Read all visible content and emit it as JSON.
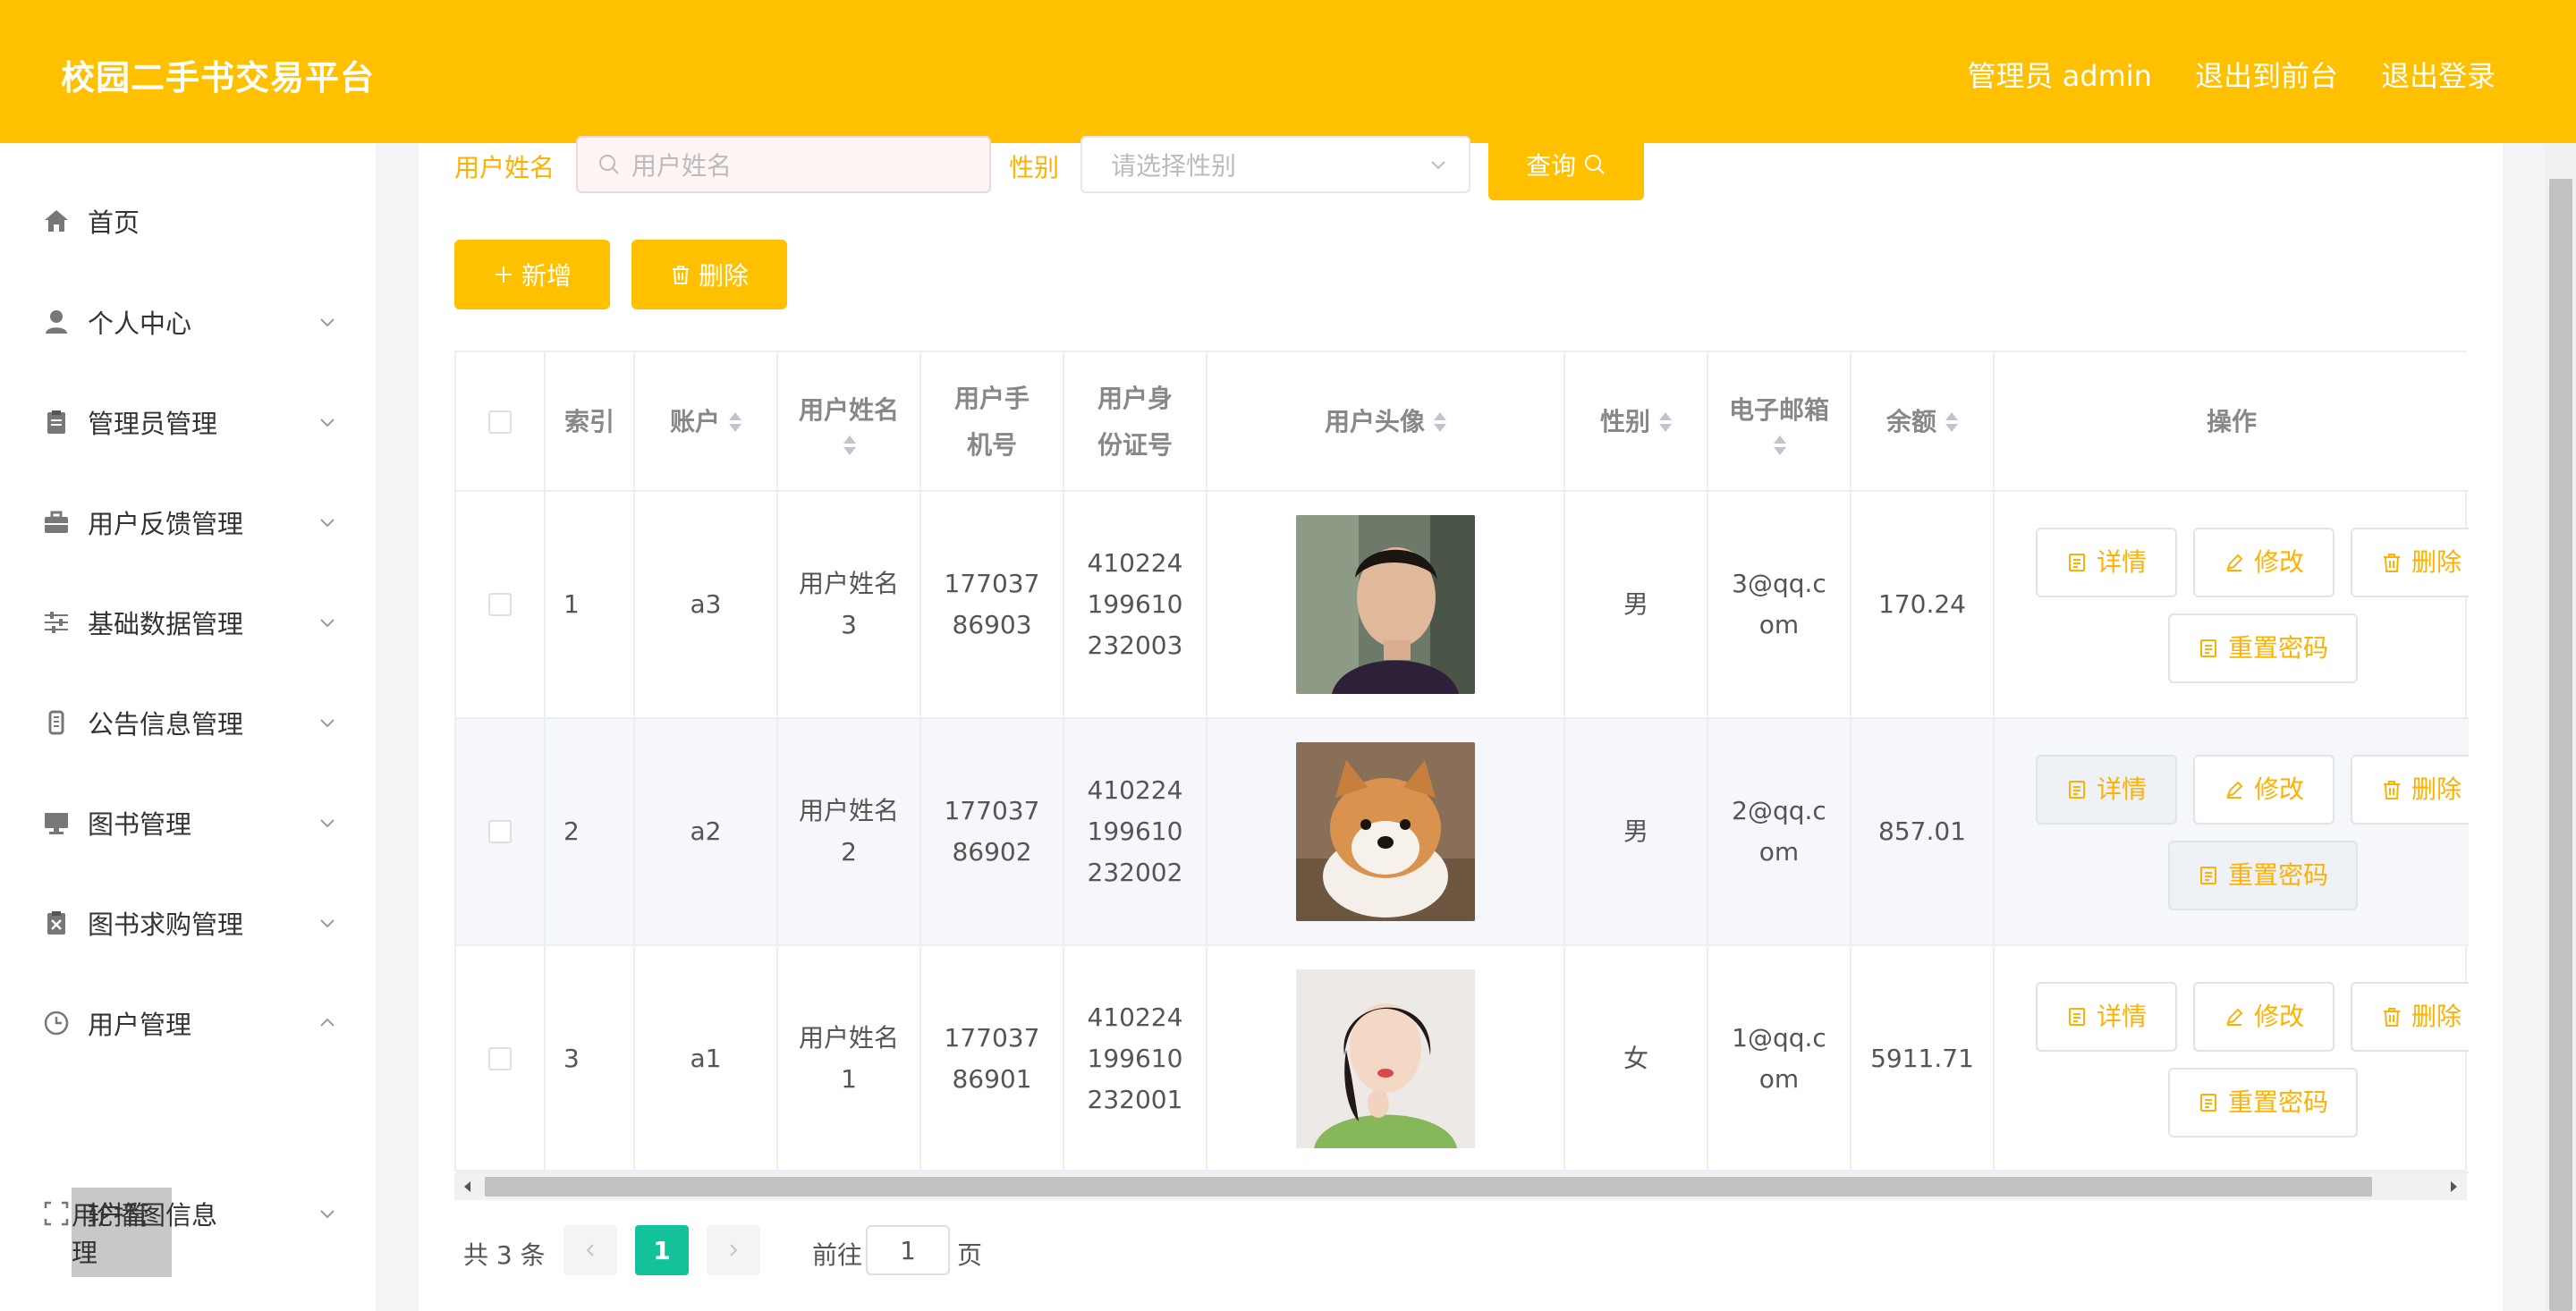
{
  "header": {
    "title": "校园二手书交易平台",
    "admin_label": "管理员 admin",
    "back_to_front": "退出到前台",
    "logout": "退出登录"
  },
  "sidebar": {
    "items": [
      {
        "label": "首页",
        "icon": "home-icon"
      },
      {
        "label": "个人中心",
        "icon": "user-icon"
      },
      {
        "label": "管理员管理",
        "icon": "clipboard-icon"
      },
      {
        "label": "用户反馈管理",
        "icon": "briefcase-icon"
      },
      {
        "label": "基础数据管理",
        "icon": "sliders-icon"
      },
      {
        "label": "公告信息管理",
        "icon": "notice-icon"
      },
      {
        "label": "图书管理",
        "icon": "monitor-icon"
      },
      {
        "label": "图书求购管理",
        "icon": "clipboard-x-icon"
      },
      {
        "label": "用户管理",
        "icon": "clock-icon"
      },
      {
        "label": "轮播图信息",
        "icon": "frame-icon"
      }
    ],
    "submenu_active": "用户管理"
  },
  "search": {
    "name_label": "用户姓名",
    "name_placeholder": "用户姓名",
    "gender_label": "性别",
    "gender_placeholder": "请选择性别",
    "query_button": "查询"
  },
  "toolbar": {
    "add_button": "新增",
    "delete_button": "删除"
  },
  "table": {
    "headers": {
      "index": "索引",
      "account": "账户",
      "name": "用户姓名",
      "phone": "用户手机号",
      "idcard": "用户身份证号",
      "avatar": "用户头像",
      "gender": "性别",
      "email": "电子邮箱",
      "balance": "余额",
      "ops": "操作"
    },
    "rows": [
      {
        "index": "1",
        "account": "a3",
        "name": "用户姓名3",
        "phone": "17703786903",
        "idcard": "410224199610232003",
        "gender": "男",
        "email": "3@qq.com",
        "balance": "170.24"
      },
      {
        "index": "2",
        "account": "a2",
        "name": "用户姓名2",
        "phone": "17703786902",
        "idcard": "410224199610232002",
        "gender": "男",
        "email": "2@qq.com",
        "balance": "857.01"
      },
      {
        "index": "3",
        "account": "a1",
        "name": "用户姓名1",
        "phone": "17703786901",
        "idcard": "410224199610232001",
        "gender": "女",
        "email": "1@qq.com",
        "balance": "5911.71"
      }
    ],
    "ops_labels": {
      "detail": "详情",
      "edit": "修改",
      "delete": "删除",
      "reset": "重置密码"
    }
  },
  "pagination": {
    "total": "共 3 条",
    "current": "1",
    "goto_label": "前往",
    "goto_value": "1",
    "page_suffix": "页"
  },
  "colors": {
    "accent": "#ffc000",
    "active_page": "#13c29a"
  }
}
